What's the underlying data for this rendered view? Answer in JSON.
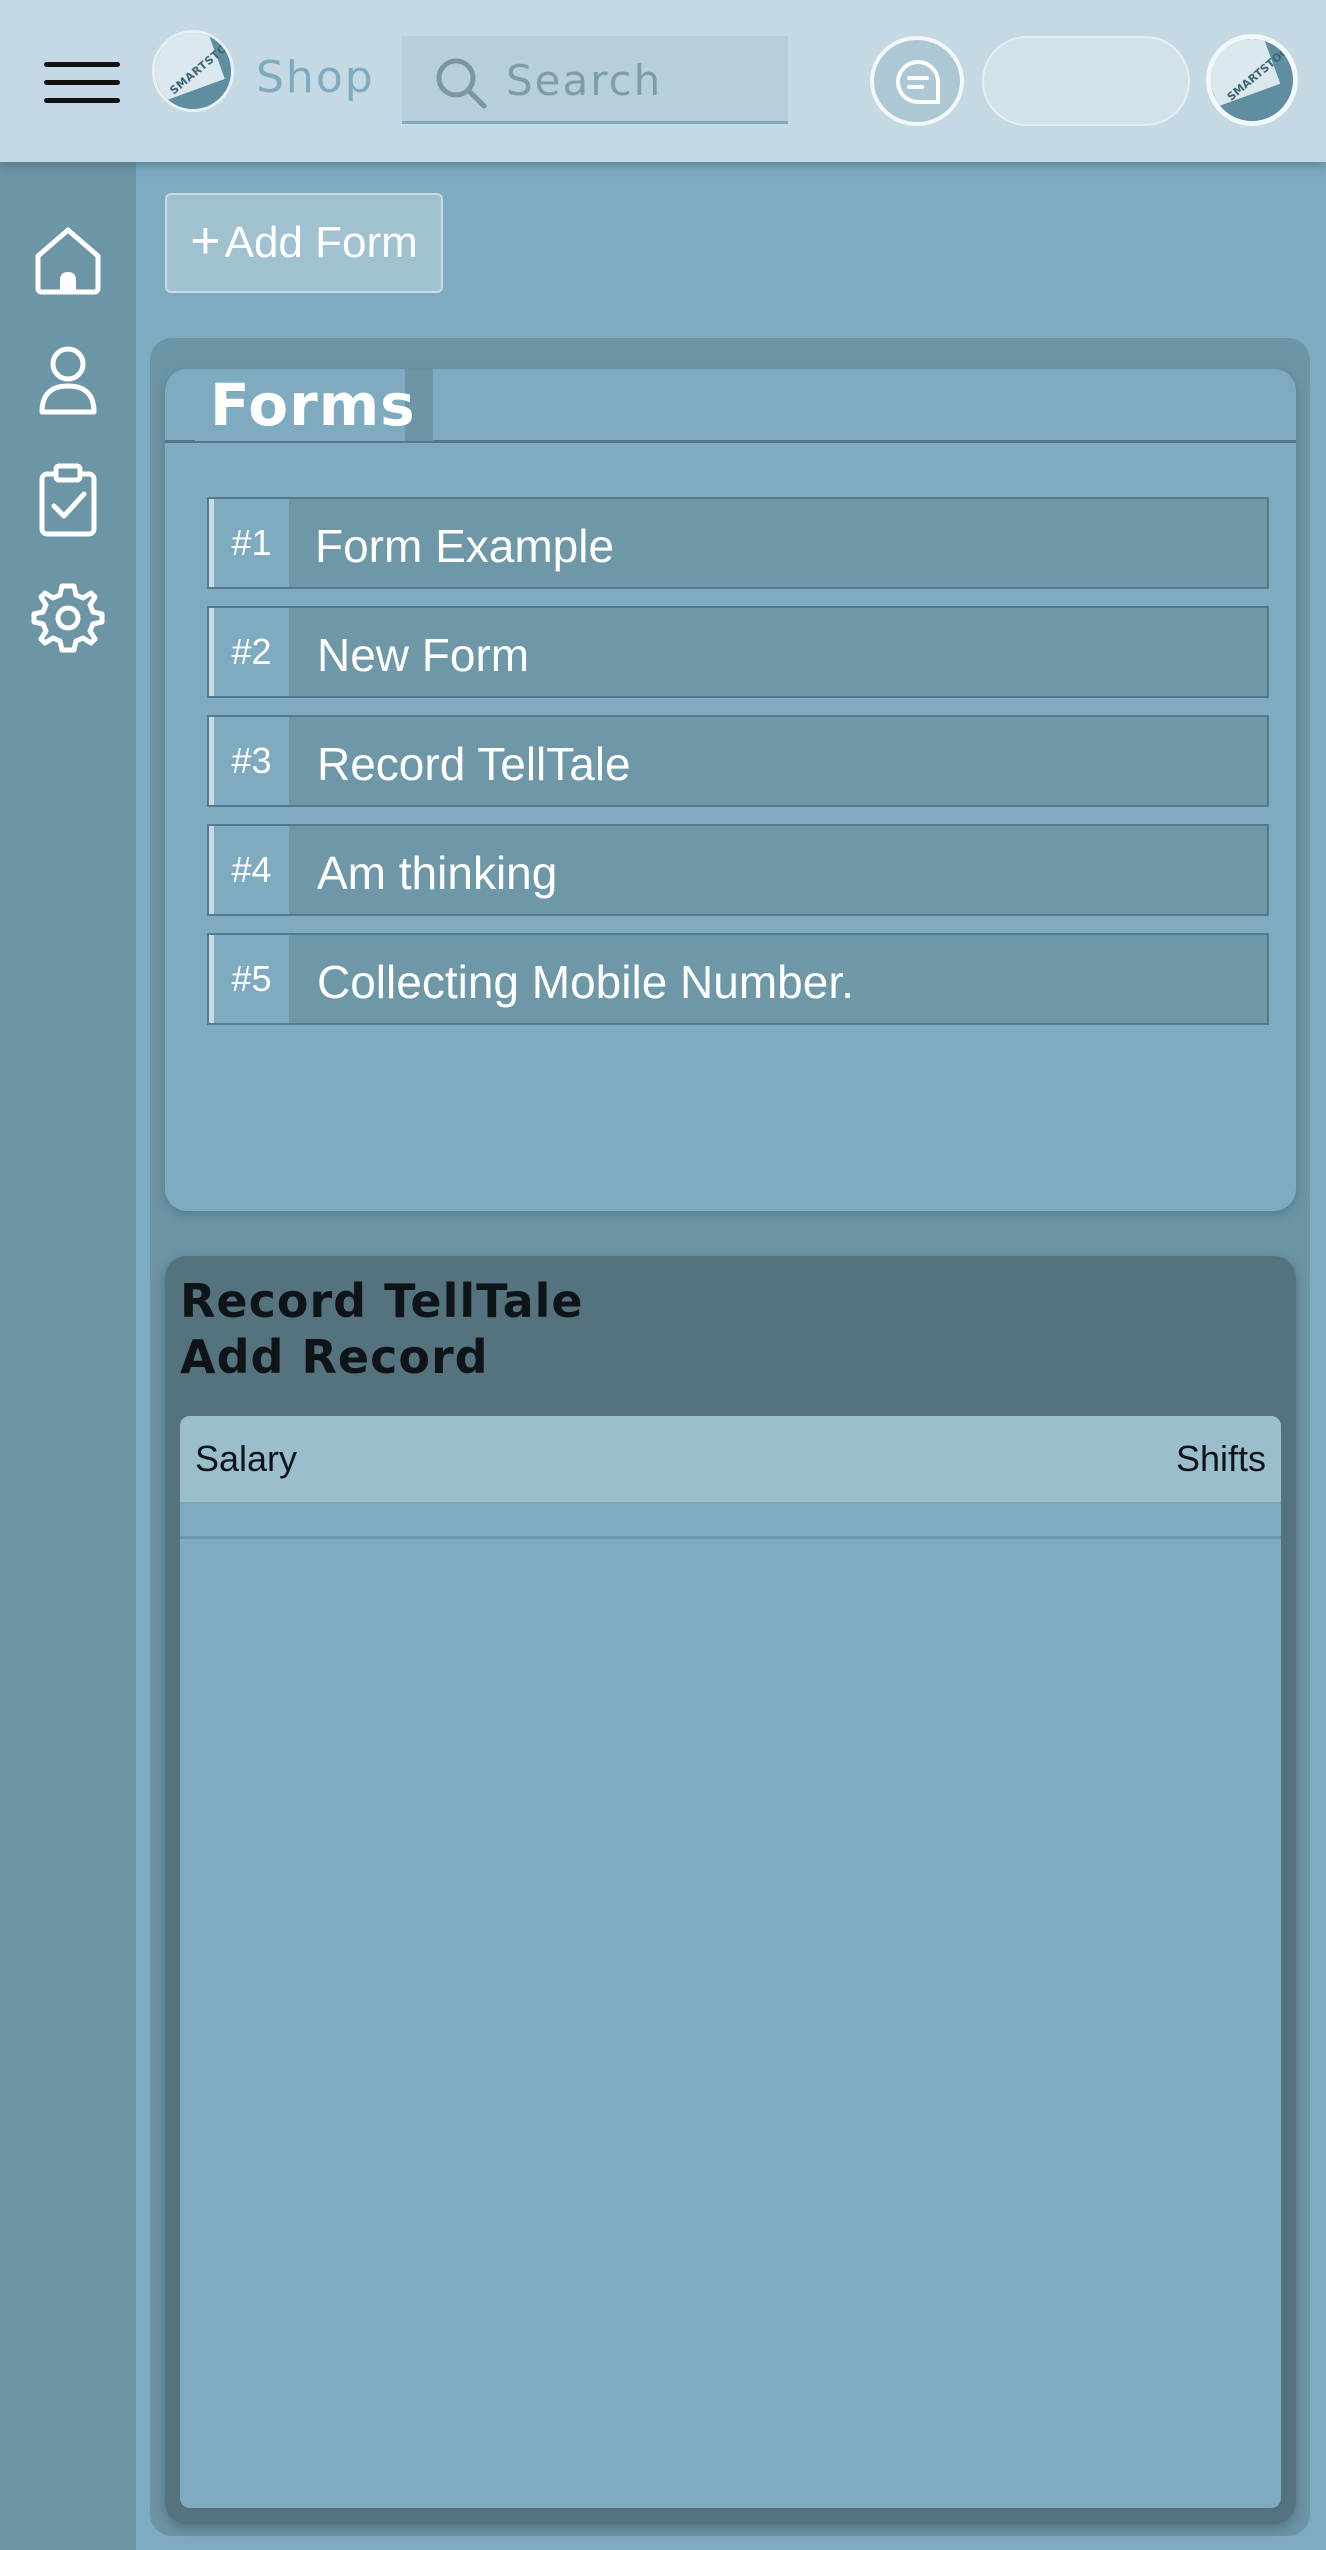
{
  "header": {
    "brand": "Shop",
    "logo_text": "SMARTSTOCK",
    "search_placeholder": "Search",
    "search_value": ""
  },
  "sidebar": {
    "items": [
      {
        "icon": "home-icon"
      },
      {
        "icon": "user-icon"
      },
      {
        "icon": "clipboard-check-icon"
      },
      {
        "icon": "gear-icon"
      }
    ]
  },
  "main": {
    "add_form_plus": "+",
    "add_form_label": "Add Form",
    "forms": {
      "title": "Forms",
      "items": [
        {
          "number": "#1",
          "name": "Form Example"
        },
        {
          "number": "#2",
          "name": "New Form"
        },
        {
          "number": "#3",
          "name": "Record TellTale"
        },
        {
          "number": "#4",
          "name": "Am thinking"
        },
        {
          "number": "#5",
          "name": "Collecting Mobile Number."
        }
      ]
    },
    "record": {
      "title": "Record TellTale",
      "add_record": "Add Record",
      "columns": [
        "Salary",
        "Shifts"
      ]
    }
  },
  "colors": {
    "topbar": "#c4d9e3",
    "page": "#7eabc0",
    "sidebar": "#6c95a6",
    "record_card": "#55737f"
  }
}
